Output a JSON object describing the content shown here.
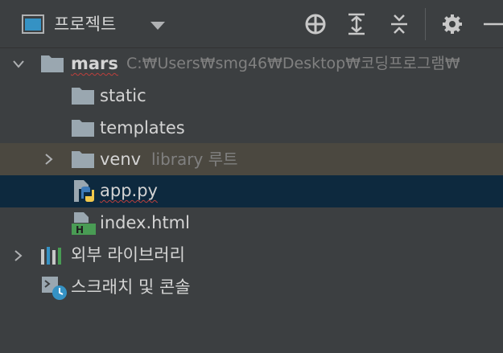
{
  "panel": {
    "title": "프로젝트",
    "dropdown_icon": "caret-down-icon"
  },
  "toolbar": {
    "buttons": [
      {
        "icon": "locate-crosshair-icon"
      },
      {
        "icon": "expand-all-icon"
      },
      {
        "icon": "collapse-all-icon"
      },
      {
        "icon": "gear-icon"
      },
      {
        "icon": "minimize-icon"
      }
    ]
  },
  "tree": {
    "root": {
      "name": "mars",
      "path": "C:₩Users₩smg46₩Desktop₩코딩프로그램₩"
    },
    "items": [
      {
        "name": "static",
        "type": "folder"
      },
      {
        "name": "templates",
        "type": "folder"
      },
      {
        "name": "venv",
        "type": "folder",
        "hint": "library 루트"
      },
      {
        "name": "app.py",
        "type": "python-file"
      },
      {
        "name": "index.html",
        "type": "html-file"
      }
    ],
    "external_libraries": "외부 라이브러리",
    "scratches": "스크래치 및 콘솔"
  },
  "colors": {
    "background": "#3c3f41",
    "text": "#d4d4d4",
    "hint": "#808080",
    "selected_active": "#0d293e",
    "selected_inactive": "#4b4840",
    "folder": "#9aa7b0",
    "error_underline": "#bc3f3c"
  }
}
